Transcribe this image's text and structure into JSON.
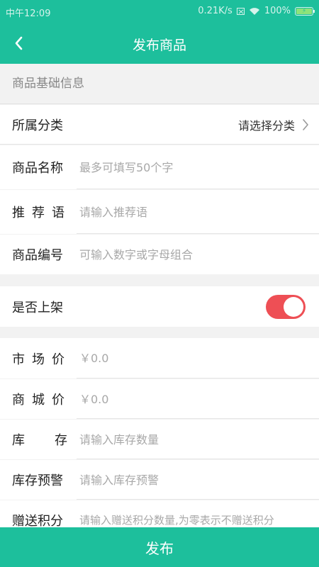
{
  "status_bar": {
    "time": "中午12:09",
    "network_speed": "0.21K/s",
    "battery": "100%"
  },
  "header": {
    "title": "发布商品",
    "back_icon": "chevron-left-icon"
  },
  "section_basic": {
    "title": "商品基础信息"
  },
  "form": {
    "category": {
      "label": "所属分类",
      "value": "请选择分类",
      "icon": "chevron-right-icon"
    },
    "name": {
      "label": "商品名称",
      "placeholder": "最多可填写50个字"
    },
    "slogan": {
      "label": "推荐语",
      "placeholder": "请输入推荐语"
    },
    "code": {
      "label": "商品编号",
      "placeholder": "可输入数字或字母组合"
    },
    "listed": {
      "label": "是否上架",
      "enabled": true,
      "accent": "#ee4f55"
    },
    "market_price": {
      "label": "市场价",
      "placeholder": "￥0.0"
    },
    "mall_price": {
      "label": "商城价",
      "placeholder": "￥0.0"
    },
    "stock": {
      "label": "库存",
      "placeholder": "请输入库存数量"
    },
    "stock_alert": {
      "label": "库存预警",
      "placeholder": "请输入库存预警"
    },
    "points": {
      "label": "赠送积分",
      "placeholder": "请输入赠送积分数量,为零表示不赠送积分"
    }
  },
  "footer": {
    "publish_label": "发布"
  },
  "colors": {
    "brand": "#1dbf9c",
    "toggle_on": "#ee4f55",
    "background": "#f2f2f2"
  }
}
